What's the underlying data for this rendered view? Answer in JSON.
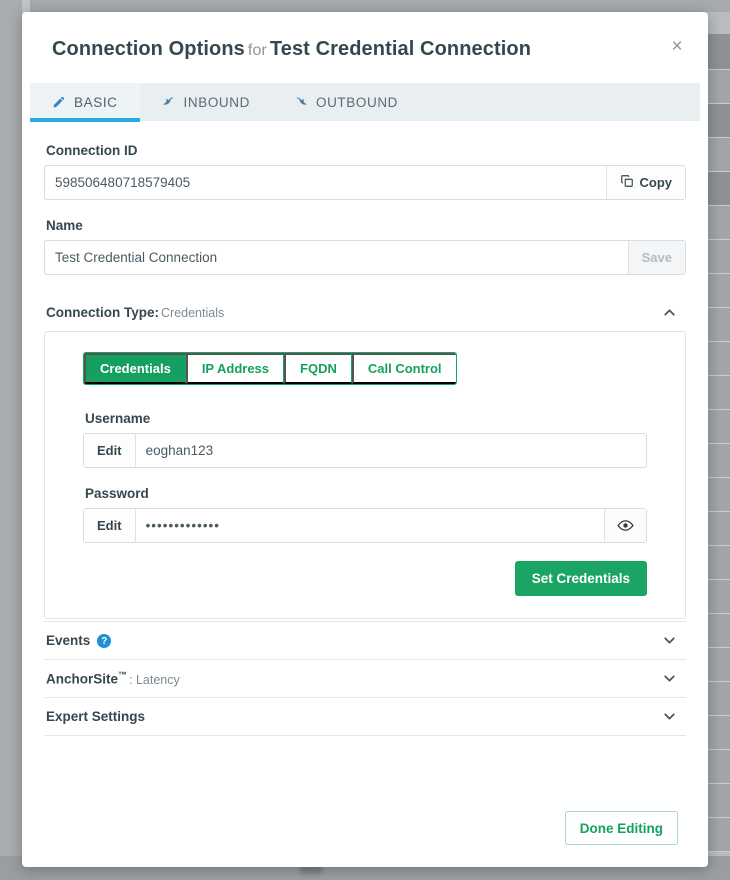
{
  "modal": {
    "title_main": "Connection Options",
    "title_for": "for",
    "title_target": "Test Credential Connection",
    "close_label": "×"
  },
  "tabs": [
    {
      "label": "BASIC",
      "icon": "pencil-icon",
      "active": true
    },
    {
      "label": "INBOUND",
      "icon": "inbound-arrow-icon",
      "active": false
    },
    {
      "label": "OUTBOUND",
      "icon": "outbound-arrow-icon",
      "active": false
    }
  ],
  "fields": {
    "connection_id": {
      "label": "Connection ID",
      "value": "598506480718579405",
      "copy_label": "Copy"
    },
    "name": {
      "label": "Name",
      "value": "Test Credential Connection",
      "save_label": "Save",
      "save_disabled": true
    }
  },
  "connection_type": {
    "label": "Connection Type:",
    "value": "Credentials",
    "expanded": true,
    "options": [
      {
        "label": "Credentials",
        "active": true
      },
      {
        "label": "IP Address",
        "active": false
      },
      {
        "label": "FQDN",
        "active": false
      },
      {
        "label": "Call Control",
        "active": false
      }
    ],
    "username": {
      "label": "Username",
      "edit_label": "Edit",
      "value": "eoghan123"
    },
    "password": {
      "label": "Password",
      "edit_label": "Edit",
      "value": "•••••••••••••",
      "reveal_icon": "eye-icon"
    },
    "set_credentials_label": "Set Credentials"
  },
  "sections": [
    {
      "title": "Events",
      "sub": "",
      "help": true,
      "tm": false
    },
    {
      "title": "AnchorSite",
      "sub": ": Latency",
      "help": false,
      "tm": true
    },
    {
      "title": "Expert Settings",
      "sub": "",
      "help": false,
      "tm": false
    }
  ],
  "footer": {
    "done_label": "Done Editing"
  },
  "colors": {
    "accent_blue": "#29abe2",
    "accent_green": "#16a05f",
    "title_text": "#37474f",
    "help_blue": "#1f8fd6",
    "tabbar_bg": "#e9eef1"
  }
}
